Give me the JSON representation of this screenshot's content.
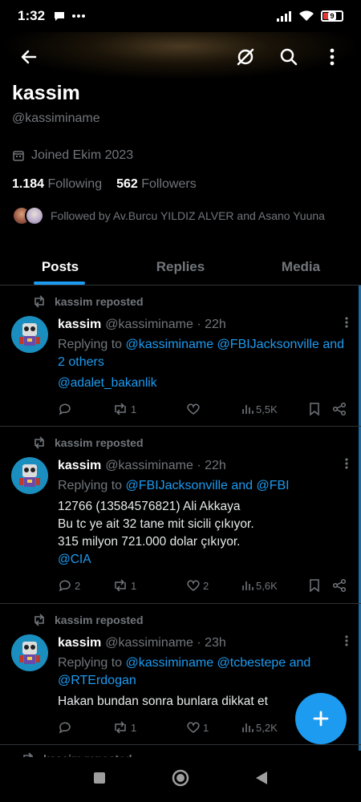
{
  "status": {
    "time": "1:32",
    "battery": "9"
  },
  "profile": {
    "name": "kassim",
    "handle": "@kassiminame",
    "joined": "Joined Ekim 2023",
    "following_count": "1.184",
    "following_label": "Following",
    "followers_count": "562",
    "followers_label": "Followers",
    "followed_by": "Followed by Av.Burcu YILDIZ ALVER and Asano Yuuna"
  },
  "tabs": [
    "Posts",
    "Replies",
    "Media"
  ],
  "posts": [
    {
      "repost_label": "kassim reposted",
      "name": "kassim",
      "meta": "@kassiminame · 22h",
      "reply_prefix": "Replying to",
      "reply_to": "@kassiminame @FBIJacksonville and 2 others",
      "text": "",
      "text_link": "@adalet_bakanlik",
      "replies": "",
      "reposts": "1",
      "likes": "",
      "views": "5,5K"
    },
    {
      "repost_label": "kassim reposted",
      "name": "kassim",
      "meta": "@kassiminame · 22h",
      "reply_prefix": "Replying to",
      "reply_to": "@FBIJacksonville and @FBI",
      "text_lines": [
        "12766 (13584576821) Ali Akkaya",
        "Bu tc ye ait 32 tane mit sicili çıkıyor.",
        "315 milyon 721.000 dolar çıkıyor."
      ],
      "text_link": "@CIA",
      "replies": "2",
      "reposts": "1",
      "likes": "2",
      "views": "5,6K"
    },
    {
      "repost_label": "kassim reposted",
      "name": "kassim",
      "meta": "@kassiminame · 23h",
      "reply_prefix": "Replying to",
      "reply_to": "@kassiminame @tcbestepe and @RTErdogan",
      "text": "Hakan bundan sonra bunlara dikkat et",
      "replies": "",
      "reposts": "1",
      "likes": "1",
      "views": "5,2K"
    }
  ],
  "partial_post": {
    "repost_label": "kassim reposted"
  },
  "colors": {
    "accent": "#1d9bf0",
    "muted": "#71767b",
    "background": "#000000"
  }
}
